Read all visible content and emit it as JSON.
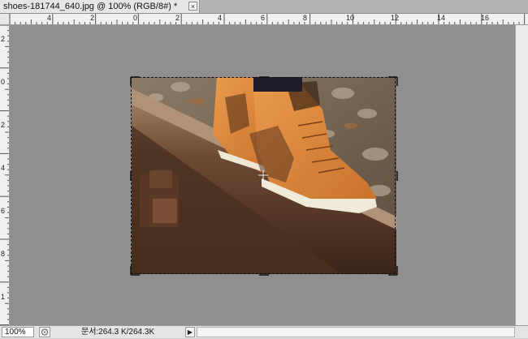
{
  "document_tab": {
    "title": "shoes-181744_640.jpg @ 100% (RGB/8#) *",
    "close_glyph": "×"
  },
  "rulers": {
    "top_labels": [
      "4",
      "2",
      "0",
      "2",
      "4",
      "6",
      "8",
      "10",
      "12",
      "14",
      "16"
    ],
    "left_labels": [
      "2",
      "0",
      "2",
      "4",
      "6",
      "8",
      "1"
    ]
  },
  "canvas": {
    "pasteboard_color": "#8f8f8f",
    "image_subject": "orange leopard-print wedge sneakers on railway track"
  },
  "status_bar": {
    "zoom": "100%",
    "doc_size": "문서:264.3 K/264.3K",
    "arrow_glyph": "▶"
  }
}
